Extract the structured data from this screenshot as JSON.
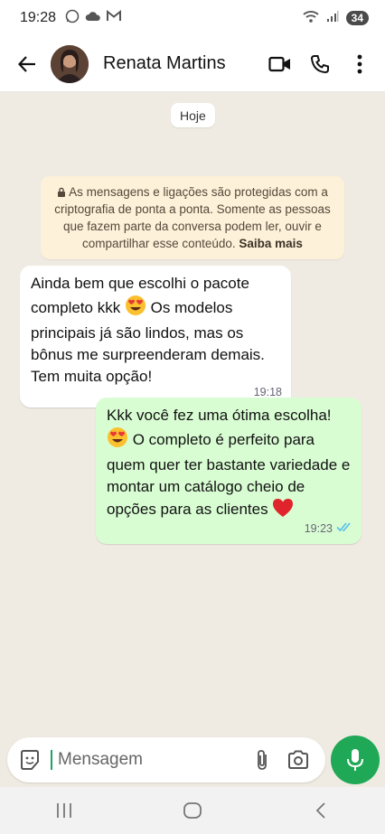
{
  "status_bar": {
    "time": "19:28",
    "battery": "34"
  },
  "header": {
    "contact_name": "Renata Martins"
  },
  "chat": {
    "date_chip": "Hoje",
    "notice": {
      "text": "As mensagens e ligações são protegidas com a criptografia de ponta a ponta. Somente as pessoas que fazem parte da conversa podem ler, ouvir e compartilhar esse conteúdo.",
      "link": "Saiba mais"
    },
    "incoming": {
      "text_1": "Ainda bem que escolhi o pacote completo kkk",
      "text_2": "Os modelos principais já são lindos, mas os bônus me surpreenderam demais. Tem muita opção!",
      "time": "19:18"
    },
    "outgoing": {
      "text_1": "Kkk você fez uma ótima escolha!",
      "text_2": "O completo é perfeito para quem quer ter bastante variedade e montar um catálogo cheio de opções para as clientes",
      "time": "19:23",
      "status": "read"
    }
  },
  "input": {
    "placeholder": "Mensagem"
  },
  "colors": {
    "accent": "#1fa855",
    "outgoing_bubble": "#d9fdd3",
    "notice_bg": "#fdf1d9",
    "read_ticks": "#53bdeb"
  }
}
